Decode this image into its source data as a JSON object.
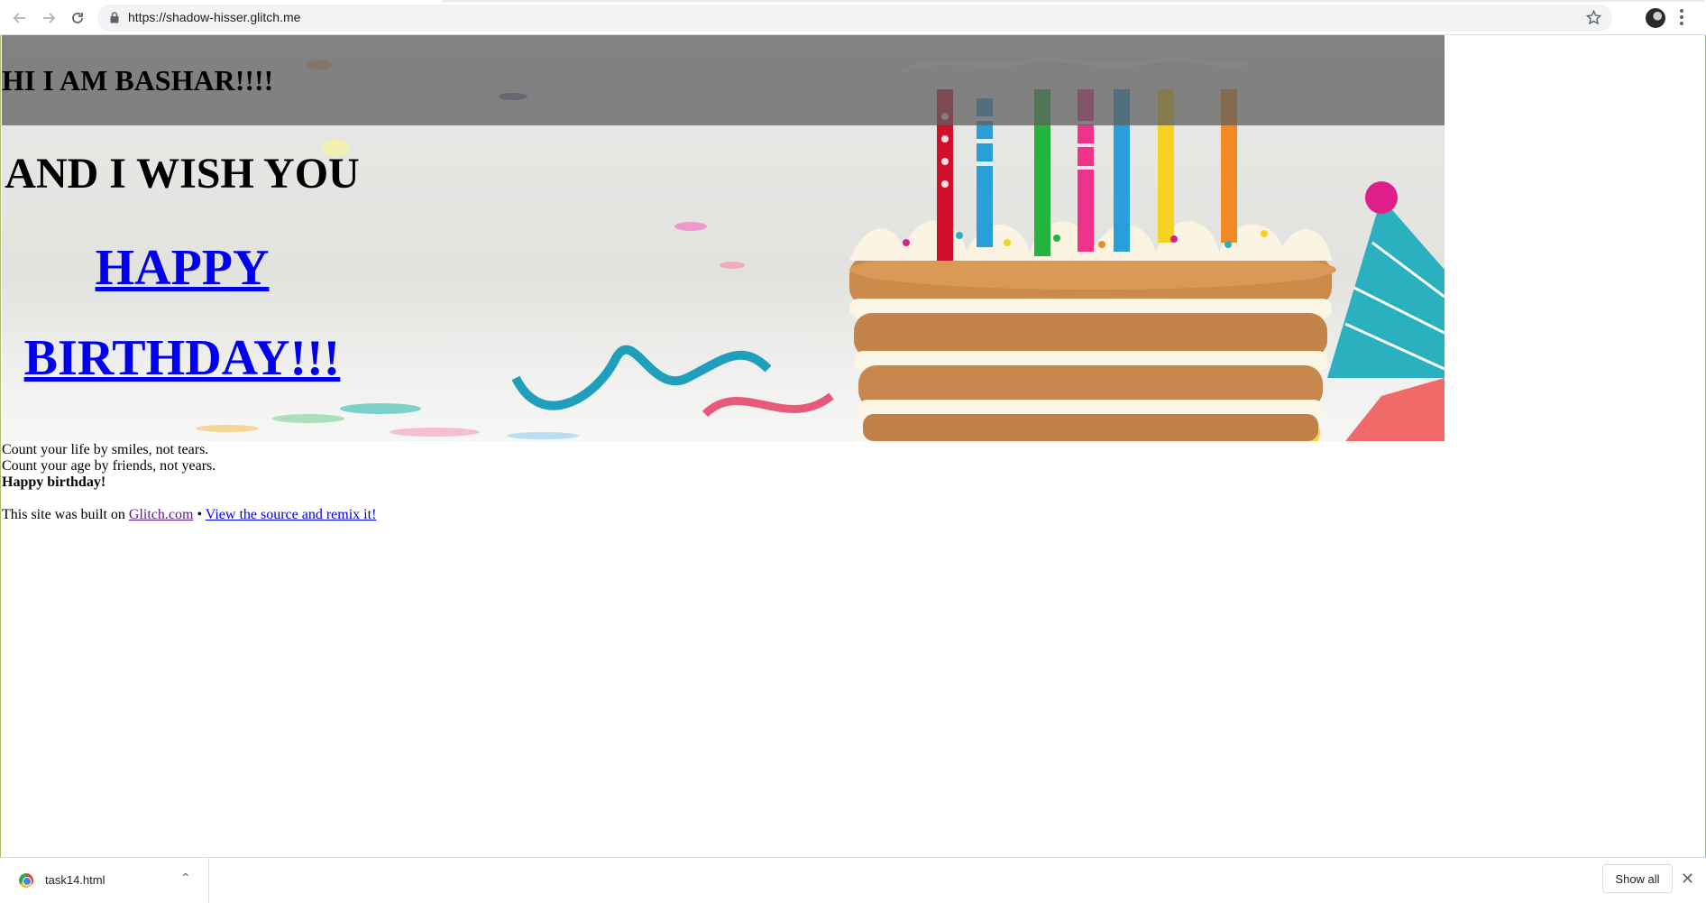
{
  "browser": {
    "url": "https://shadow-hisser.glitch.me",
    "back_icon": "arrow-left-icon",
    "forward_icon": "arrow-right-icon",
    "reload_icon": "reload-icon",
    "lock_icon": "lock-icon",
    "bookmark_icon": "star-icon"
  },
  "hero": {
    "title": "HI I AM BASHAR!!!!",
    "line1": "AND I WISH YOU",
    "line2": "HAPPY",
    "line3": "BIRTHDAY!!!"
  },
  "content": {
    "line1": "Count your life by smiles, not tears.",
    "line2": "Count your age by friends, not years.",
    "line3": "Happy birthday!",
    "footer_prefix": "This site was built on ",
    "glitch_link": "Glitch.com",
    "separator": " • ",
    "remix_link": "View the source and remix it!"
  },
  "download_bar": {
    "file_name": "task14.html",
    "show_all": "Show all"
  },
  "colors": {
    "link": "#0000ee",
    "visited_link": "#551a8b",
    "hero_bar": "#5f5f5f"
  }
}
